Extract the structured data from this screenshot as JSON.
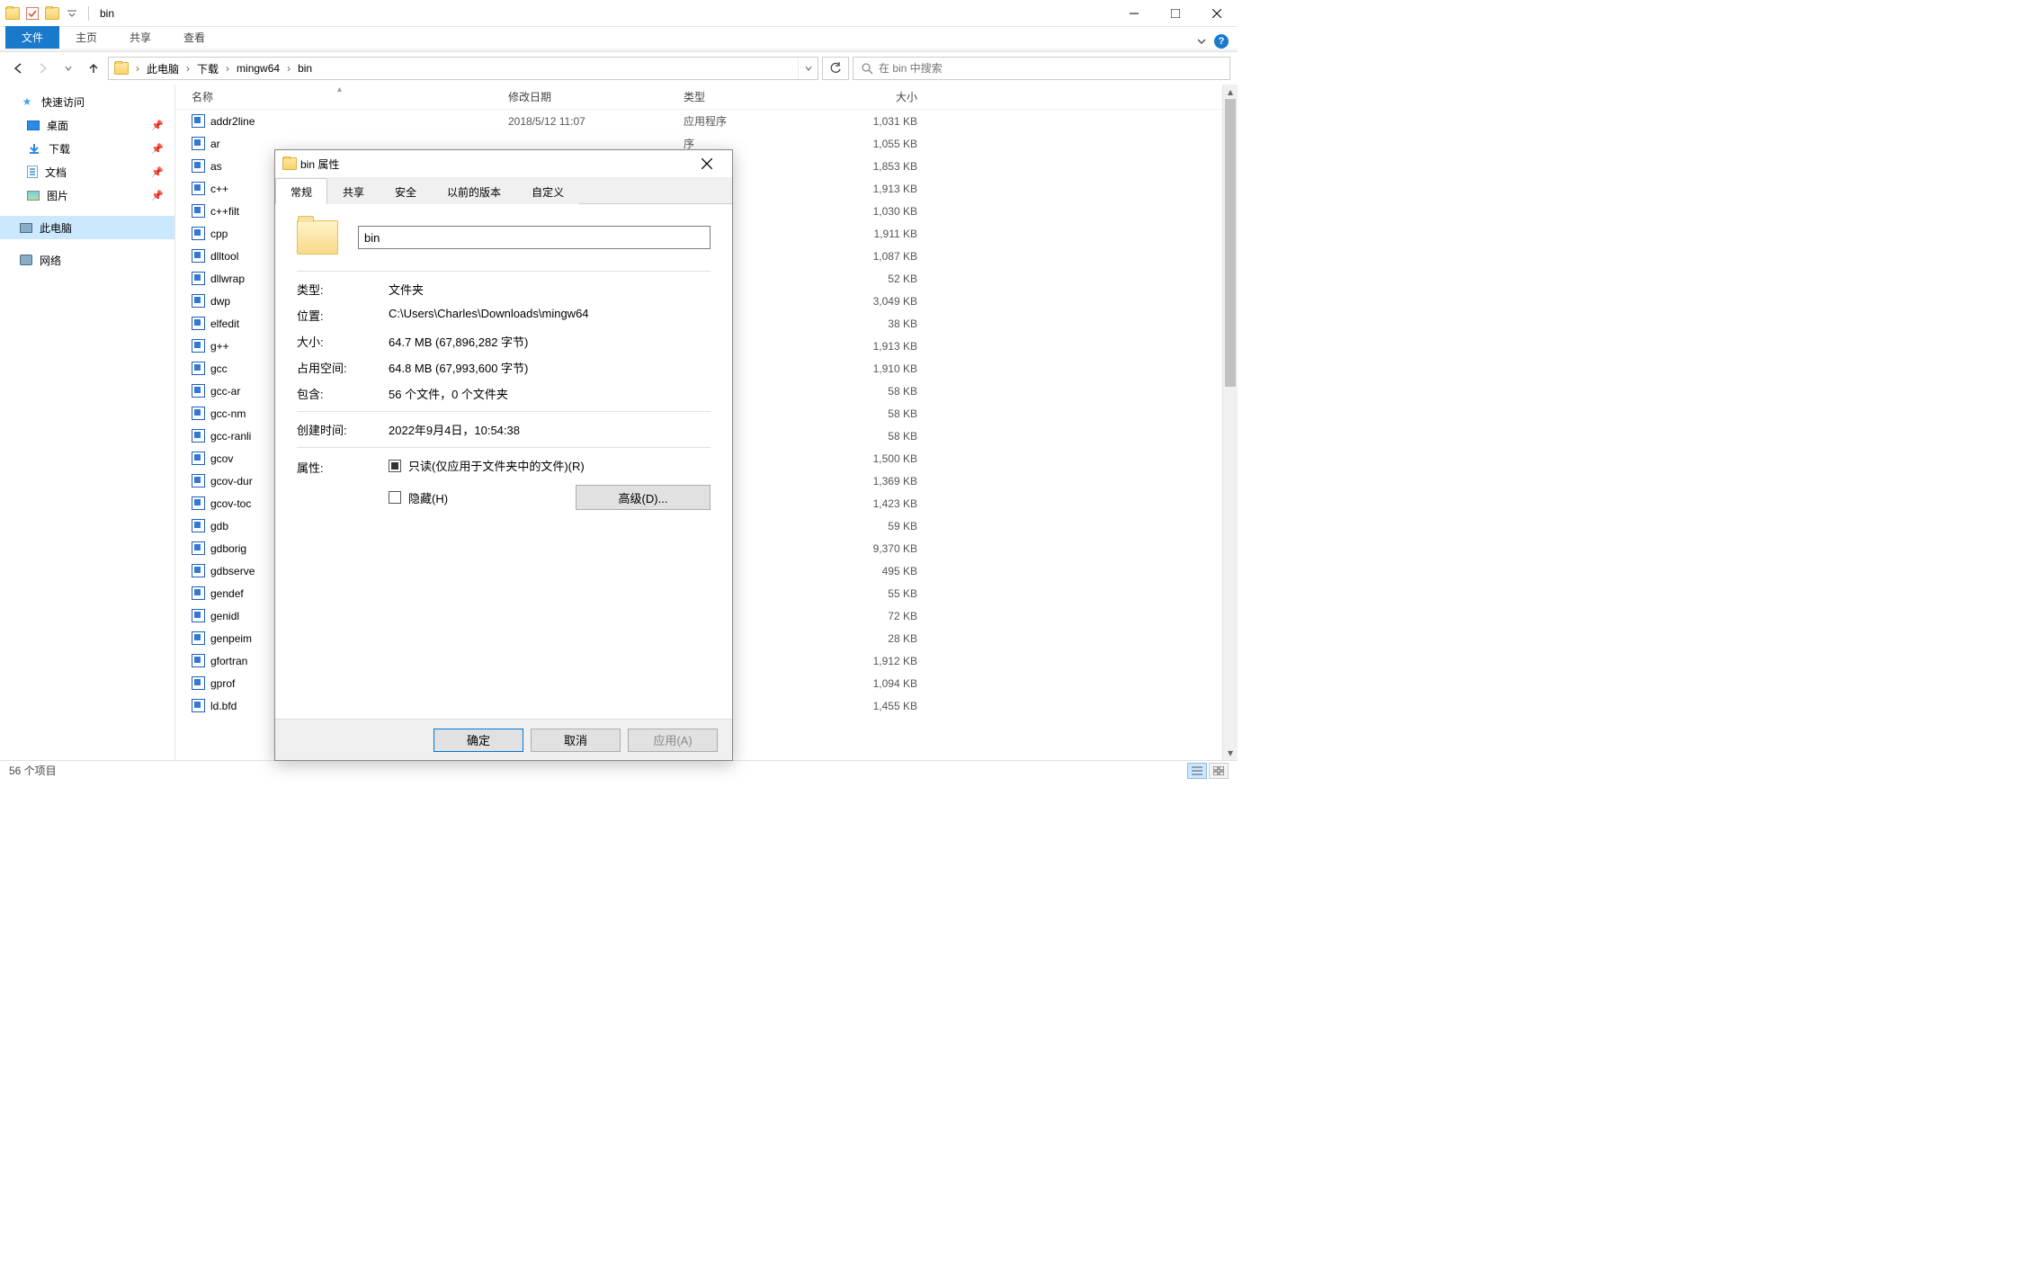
{
  "window": {
    "title": "bin",
    "tabs": {
      "file": "文件",
      "home": "主页",
      "share": "共享",
      "view": "查看"
    }
  },
  "nav": {
    "breadcrumb": [
      "此电脑",
      "下载",
      "mingw64",
      "bin"
    ],
    "search_placeholder": "在 bin 中搜索"
  },
  "sidebar": {
    "quick": "快速访问",
    "desktop": "桌面",
    "downloads": "下载",
    "documents": "文档",
    "pictures": "图片",
    "thispc": "此电脑",
    "network": "网络"
  },
  "columns": {
    "name": "名称",
    "date": "修改日期",
    "type": "类型",
    "size": "大小"
  },
  "shared_date": "2018/5/12 11:07",
  "shared_type": "应用程序",
  "obscured_type": "序",
  "files": [
    {
      "name": "addr2line",
      "size": "1,031 KB",
      "show_date": true,
      "show_type": true
    },
    {
      "name": "ar",
      "size": "1,055 KB"
    },
    {
      "name": "as",
      "size": "1,853 KB"
    },
    {
      "name": "c++",
      "size": "1,913 KB"
    },
    {
      "name": "c++filt",
      "size": "1,030 KB"
    },
    {
      "name": "cpp",
      "size": "1,911 KB"
    },
    {
      "name": "dlltool",
      "size": "1,087 KB"
    },
    {
      "name": "dllwrap",
      "size": "52 KB"
    },
    {
      "name": "dwp",
      "size": "3,049 KB"
    },
    {
      "name": "elfedit",
      "size": "38 KB"
    },
    {
      "name": "g++",
      "size": "1,913 KB"
    },
    {
      "name": "gcc",
      "size": "1,910 KB"
    },
    {
      "name": "gcc-ar",
      "size": "58 KB"
    },
    {
      "name": "gcc-nm",
      "size": "58 KB"
    },
    {
      "name": "gcc-ranli",
      "size": "58 KB",
      "truncated": true
    },
    {
      "name": "gcov",
      "size": "1,500 KB"
    },
    {
      "name": "gcov-dur",
      "size": "1,369 KB",
      "truncated": true
    },
    {
      "name": "gcov-toc",
      "size": "1,423 KB",
      "truncated": true
    },
    {
      "name": "gdb",
      "size": "59 KB"
    },
    {
      "name": "gdborig",
      "size": "9,370 KB"
    },
    {
      "name": "gdbserve",
      "size": "495 KB",
      "truncated": true
    },
    {
      "name": "gendef",
      "size": "55 KB"
    },
    {
      "name": "genidl",
      "size": "72 KB"
    },
    {
      "name": "genpeim",
      "size": "28 KB",
      "truncated": true
    },
    {
      "name": "gfortran",
      "size": "1,912 KB"
    },
    {
      "name": "gprof",
      "size": "1,094 KB"
    },
    {
      "name": "ld.bfd",
      "size": "1,455 KB"
    }
  ],
  "status": {
    "items": "56 个项目"
  },
  "dialog": {
    "title": "bin 属性",
    "tabs": {
      "general": "常规",
      "share": "共享",
      "security": "安全",
      "previous": "以前的版本",
      "custom": "自定义"
    },
    "name_value": "bin",
    "labels": {
      "type": "类型:",
      "location": "位置:",
      "dsize": "大小:",
      "disk": "占用空间:",
      "contains": "包含:",
      "created": "创建时间:",
      "attrs": "属性:"
    },
    "values": {
      "type": "文件夹",
      "location": "C:\\Users\\Charles\\Downloads\\mingw64",
      "dsize": "64.7 MB (67,896,282 字节)",
      "disk": "64.8 MB (67,993,600 字节)",
      "contains": "56 个文件，0 个文件夹",
      "created": "2022年9月4日，10:54:38"
    },
    "readonly_label": "只读(仅应用于文件夹中的文件)(R)",
    "hidden_label": "隐藏(H)",
    "advanced": "高级(D)...",
    "ok": "确定",
    "cancel": "取消",
    "apply": "应用(A)"
  }
}
